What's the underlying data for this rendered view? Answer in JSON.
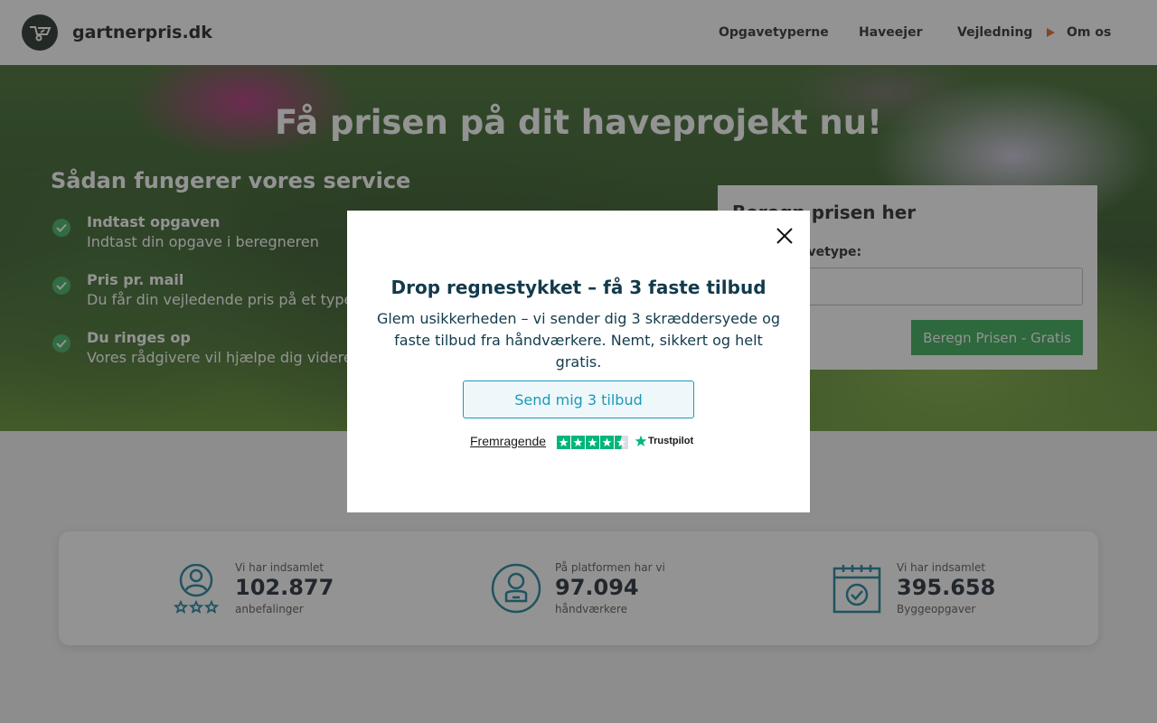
{
  "header": {
    "brand": "gartnerpris.dk",
    "nav": [
      {
        "label": "Opgavetyperne"
      },
      {
        "label": "Haveejer"
      },
      {
        "label": "Vejledning"
      },
      {
        "label": "Om os"
      }
    ]
  },
  "hero": {
    "title": "Få prisen på dit haveprojekt nu!",
    "service_title": "Sådan fungerer vores service",
    "steps": [
      {
        "title": "Indtast opgaven",
        "desc": "Indtast din opgave i beregneren"
      },
      {
        "title": "Pris pr. mail",
        "desc": "Du får din vejledende pris på et typehus"
      },
      {
        "title": "Du ringes op",
        "desc": "Vores rådgivere vil hjælpe dig videre med opgaven"
      }
    ]
  },
  "calculator": {
    "title": "Beregn prisen her",
    "label": "Vælg opgavetype:",
    "select_value": "",
    "button": "Beregn Prisen - Gratis"
  },
  "stats": [
    {
      "pre": "Vi har indsamlet",
      "num": "102.877",
      "post": "anbefalinger",
      "icon": "user-stars-icon"
    },
    {
      "pre": "På platformen har vi",
      "num": "97.094",
      "post": "håndværkere",
      "icon": "craftsman-icon"
    },
    {
      "pre": "Vi har indsamlet",
      "num": "395.658",
      "post": "Byggeopgaver",
      "icon": "calendar-check-icon"
    }
  ],
  "modal": {
    "title": "Drop regnestykket – få 3 faste tilbud",
    "text": "Glem usikkerheden – vi sender dig 3 skræddersyede og faste tilbud fra håndværkere. Nemt, sikkert og helt gratis.",
    "button": "Send mig 3 tilbud",
    "trustpilot_rating": "Fremragende",
    "trustpilot_brand": "Trustpilot",
    "trustpilot_stars": 4.5
  },
  "colors": {
    "accent": "#1b9ab7",
    "green": "#34a853",
    "check": "#3cb15e",
    "nav_arrow": "#e0661b",
    "trustpilot": "#00b67a"
  }
}
